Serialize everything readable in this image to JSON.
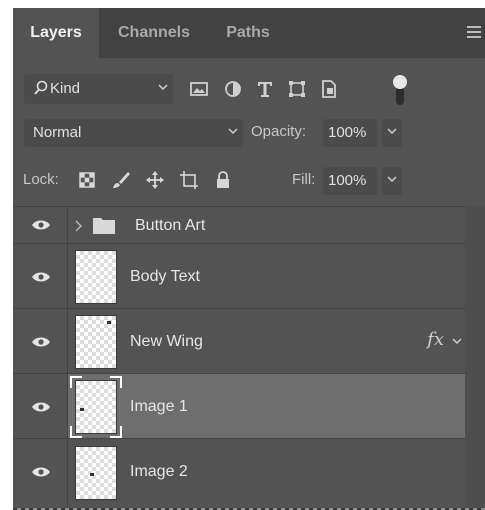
{
  "tabs": [
    {
      "label": "Layers",
      "active": true
    },
    {
      "label": "Channels",
      "active": false
    },
    {
      "label": "Paths",
      "active": false
    }
  ],
  "panel_menu_icon": "hamburger-menu-icon",
  "filter": {
    "kind_label": "Kind",
    "icons": [
      "image-filter-icon",
      "adjustment-filter-icon",
      "type-filter-icon",
      "shape-filter-icon",
      "smart-object-filter-icon",
      "filter-toggle-icon"
    ]
  },
  "blend": {
    "mode": "Normal",
    "opacity_label": "Opacity:",
    "opacity_value": "100%",
    "fill_label": "Fill:",
    "fill_value": "100%"
  },
  "lock": {
    "label": "Lock:",
    "icons": [
      "lock-transparent-pixels-icon",
      "lock-image-pixels-icon",
      "lock-position-icon",
      "lock-artboard-icon",
      "lock-all-icon"
    ]
  },
  "layers": [
    {
      "name": "Button Art",
      "type": "group",
      "visible": true,
      "selected": false
    },
    {
      "name": "Body Text",
      "type": "layer",
      "visible": true,
      "selected": false
    },
    {
      "name": "New Wing",
      "type": "layer",
      "visible": true,
      "selected": false,
      "fx": "fx"
    },
    {
      "name": "Image 1",
      "type": "layer",
      "visible": true,
      "selected": true
    },
    {
      "name": "Image 2",
      "type": "layer",
      "visible": true,
      "selected": false
    }
  ],
  "colors": {
    "panel_bg": "#535353",
    "tabbar_bg": "#424242",
    "selected_row": "#6e6e6e",
    "text": "#e6e6e6"
  }
}
